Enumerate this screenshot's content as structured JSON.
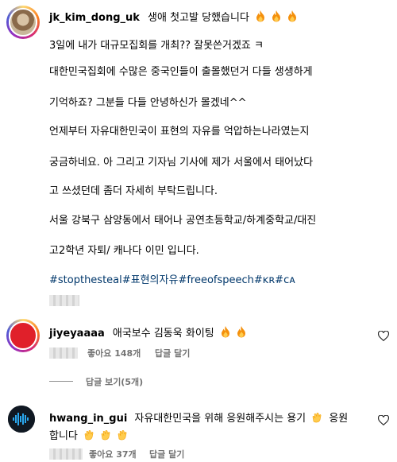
{
  "post": {
    "username": "jk_kim_dong_uk",
    "caption_first": "생애 첫고발 당했습니다",
    "fire_count": 3,
    "lines": [
      "3일에 내가 대규모집회를 개최?? 잘못쓴거겠죠 ㅋ",
      "대한민국집회에 수많은 중국인들이 출몰했던거 다들 생생하게",
      "기억하죠? 그분들 다들 안녕하신가 몰겠네^^",
      "언제부터 자유대한민국이 표현의 자유를 억압하는나라였는지",
      "궁금하네요. 아 그리고 기자님 기사에 제가 서울에서 태어났다",
      "고 쓰셨던데 좀더 자세히 부탁드립니다.",
      "서울 강북구 삼양동에서 태어나 공연초등학교/하계중학교/대진",
      "고2학년 자퇴/ 캐나다 이민 입니다."
    ],
    "hashtags": "#stopthesteal#표현의자유#freeofspeech#ĸʀ#ᴄᴀ"
  },
  "comments": [
    {
      "username": "jiyeyaaaa",
      "text": "애국보수 김동욱 화이팅",
      "fire_count": 2,
      "likes": "좋아요 148개",
      "reply": "답글 달기",
      "view_replies": "답글 보기(5개)"
    },
    {
      "username": "hwang_in_gui",
      "text_line1": "자유대한민국을 위해 응원해주시는 용기",
      "text_line1_end": "응원",
      "text_line2": "합니다",
      "likes": "좋아요 37개",
      "reply": "답글 달기"
    }
  ],
  "icons": {
    "fire": "fire-emoji-icon",
    "clap": "clapping-hands-emoji-icon",
    "heart": "heart-outline-icon"
  }
}
